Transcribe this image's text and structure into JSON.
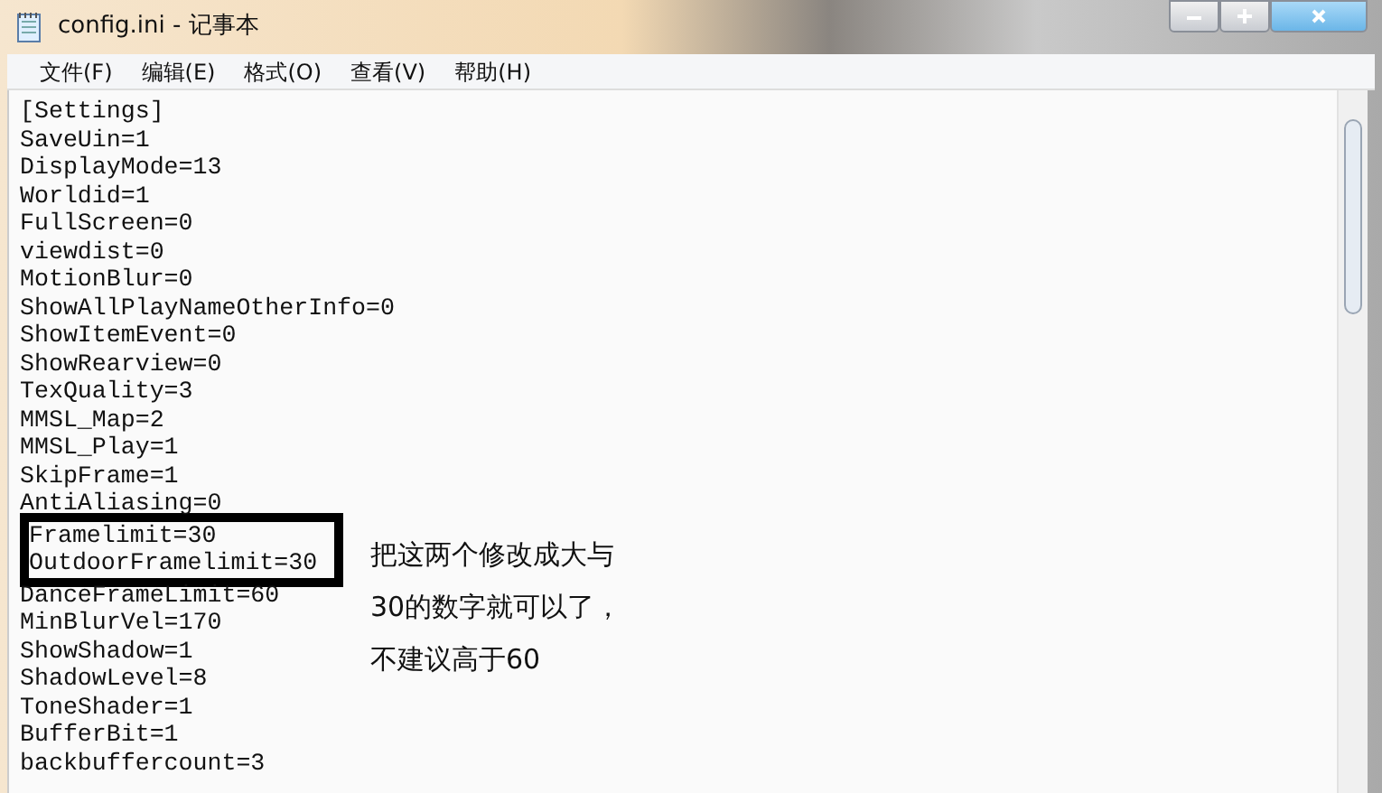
{
  "window": {
    "title": "config.ini - 记事本"
  },
  "menu": [
    "文件(F)",
    "编辑(E)",
    "格式(O)",
    "查看(V)",
    "帮助(H)"
  ],
  "lines": [
    {
      "text": "[Settings]",
      "boxed": false
    },
    {
      "text": "SaveUin=1",
      "boxed": false
    },
    {
      "text": "DisplayMode=13",
      "boxed": false
    },
    {
      "text": "Worldid=1",
      "boxed": false
    },
    {
      "text": "FullScreen=0",
      "boxed": false
    },
    {
      "text": "viewdist=0",
      "boxed": false
    },
    {
      "text": "MotionBlur=0",
      "boxed": false
    },
    {
      "text": "ShowAllPlayNameOtherInfo=0",
      "boxed": false
    },
    {
      "text": "ShowItemEvent=0",
      "boxed": false
    },
    {
      "text": "ShowRearview=0",
      "boxed": false
    },
    {
      "text": "TexQuality=3",
      "boxed": false
    },
    {
      "text": "MMSL_Map=2",
      "boxed": false
    },
    {
      "text": "MMSL_Play=1",
      "boxed": false
    },
    {
      "text": "SkipFrame=1",
      "boxed": false
    },
    {
      "text": "AntiAliasing=0",
      "boxed": false
    },
    {
      "text": "Framelimit=30",
      "boxed": true
    },
    {
      "text": "OutdoorFramelimit=30",
      "boxed": true
    },
    {
      "text": "DanceFrameLimit=60",
      "boxed": false
    },
    {
      "text": "MinBlurVel=170",
      "boxed": false
    },
    {
      "text": "ShowShadow=1",
      "boxed": false
    },
    {
      "text": "ShadowLevel=8",
      "boxed": false
    },
    {
      "text": "ToneShader=1",
      "boxed": false
    },
    {
      "text": "BufferBit=1",
      "boxed": false
    },
    {
      "text": "backbuffercount=3",
      "boxed": false
    }
  ],
  "annotation": [
    "把这两个修改成大与",
    "30的数字就可以了，",
    "不建议高于60"
  ]
}
